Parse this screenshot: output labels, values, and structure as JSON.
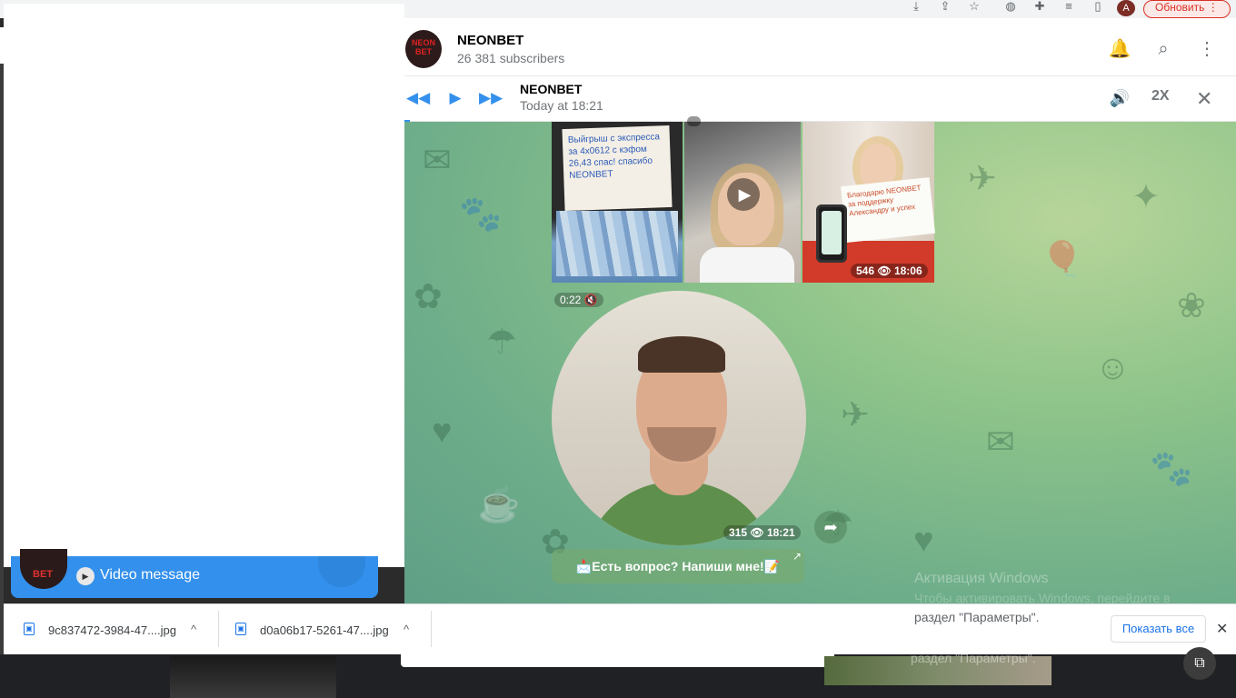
{
  "browser": {
    "profile_initial": "A",
    "update_button": "Обновить",
    "icons": [
      "download-icon",
      "share-icon",
      "star-icon",
      "extension-icon",
      "puzzle-icon",
      "media-icon",
      "sidepanel-icon",
      "menu-icon"
    ]
  },
  "sidebar": {
    "video_message_label": "Video message",
    "avatar_text": "BET"
  },
  "channel": {
    "avatar_text": "NEON BET",
    "title": "NEONBET",
    "subscribers": "26 381 subscribers"
  },
  "player": {
    "title": "NEONBET",
    "time": "Today at 18:21",
    "speed": "2X"
  },
  "album": {
    "photo1_sign": "Выйгрыш с экспресса за 4х0612 с кэфом 26,43 спас! спасибо NEONBET",
    "photo3_sign": "Благодарю NEONBET за поддержку Александру и успех",
    "views": "546",
    "time": "18:06"
  },
  "video_message": {
    "duration": "0:22",
    "views": "315",
    "time": "18:21"
  },
  "inline_button": {
    "label": "📩Есть вопрос? Напиши мне!📝"
  },
  "watermark": {
    "line1": "Активация Windows",
    "line2": "Чтобы активировать Windows, перейдите в",
    "line3": "раздел \"Параметры\"."
  },
  "downloads": {
    "items": [
      {
        "name": "9c837472-3984-47....jpg"
      },
      {
        "name": "d0a06b17-5261-47....jpg"
      }
    ],
    "show_all": "Показать все"
  },
  "bottom": {
    "watermark_text": "раздел \"Параметры\"."
  },
  "colors": {
    "accent": "#3390ec",
    "chat_bg": "#8ec48a",
    "update_red": "#d93025"
  }
}
